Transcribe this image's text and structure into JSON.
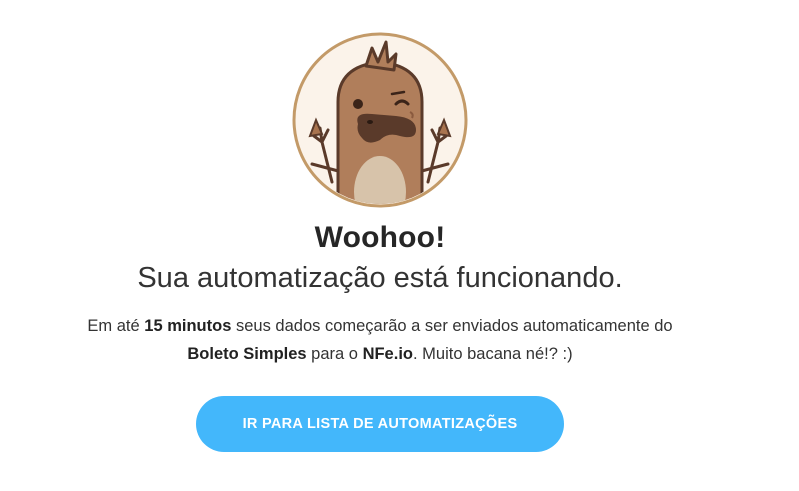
{
  "success": {
    "headline": "Woohoo!",
    "subheadline": "Sua automatização está funcionando.",
    "message": {
      "part1": "Em até ",
      "duration": "15 minutos",
      "part2": " seus dados começarão a ser enviados automaticamente do",
      "source": "Boleto Simples",
      "part3": " para o ",
      "destination": "NFe.io",
      "part4": ". Muito bacana né!? :)"
    },
    "mascot_icon": "platypus-mascot-icon"
  },
  "cta": {
    "label": "IR PARA LISTA DE AUTOMATIZAÇÕES"
  },
  "colors": {
    "button": "#43b7fb",
    "button_text": "#ffffff",
    "mascot_ring": "#c39a68",
    "mascot_bg": "#fbf3ea",
    "mascot_body": "#b07e5b"
  }
}
